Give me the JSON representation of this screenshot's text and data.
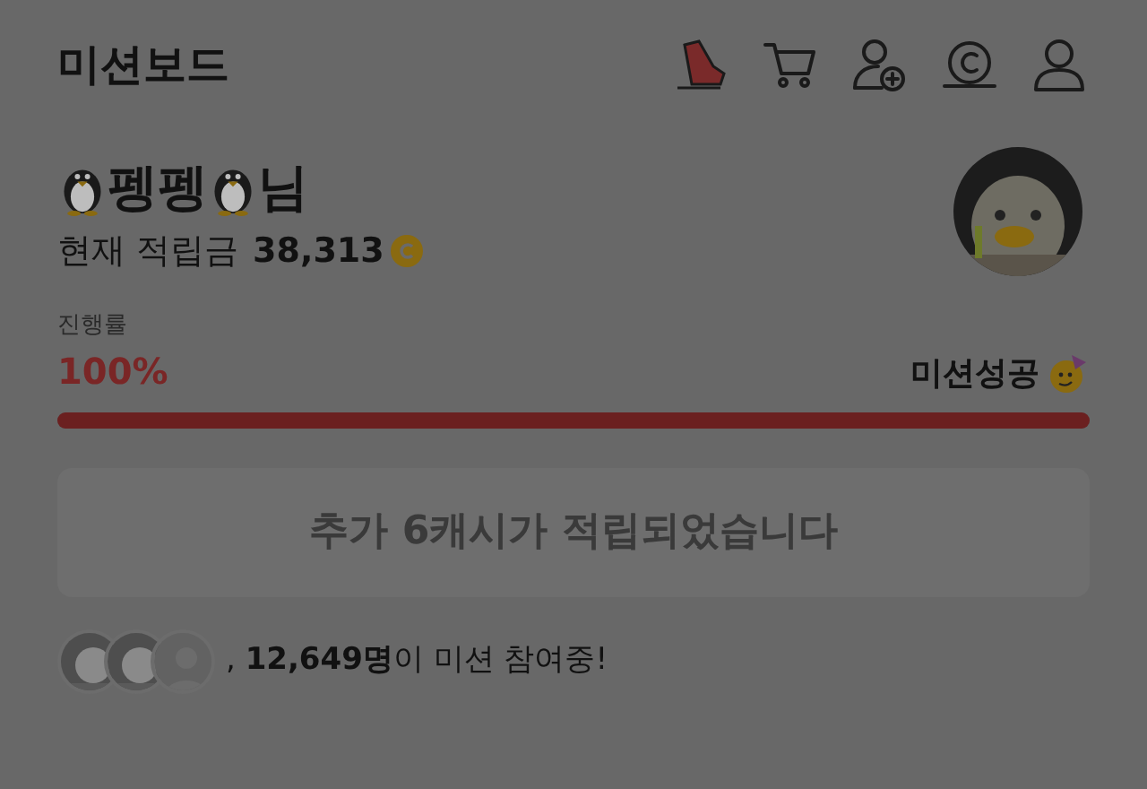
{
  "header": {
    "title": "미션보드",
    "icons": [
      {
        "kind": "shoe"
      },
      {
        "kind": "cart"
      },
      {
        "kind": "add-user"
      },
      {
        "kind": "coin"
      },
      {
        "kind": "user"
      }
    ]
  },
  "profile": {
    "name_parts": [
      "펭펭",
      "님"
    ],
    "balance_label": "현재 적립금",
    "balance": "38,313"
  },
  "progress": {
    "label": "진행률",
    "percent": "100%",
    "status": "미션성공",
    "level": 1
  },
  "notice": "추가 6캐시가 적립되었습니다",
  "participants": {
    "text": ", **12,649명**이 미션 참여중!",
    "avatars": [
      {
        "kind": "picture"
      },
      {
        "kind": "picture"
      },
      {
        "kind": "blank"
      }
    ]
  }
}
